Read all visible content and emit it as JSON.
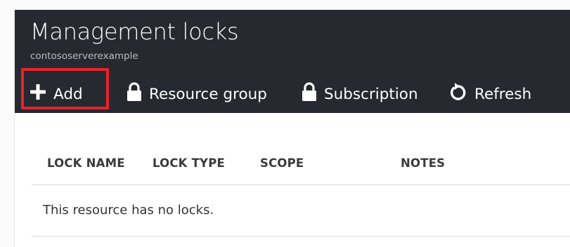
{
  "blade": {
    "title": "Management locks",
    "subtitle": "contososerverexample"
  },
  "toolbar": {
    "add_label": "Add",
    "resource_group_label": "Resource group",
    "subscription_label": "Subscription",
    "refresh_label": "Refresh"
  },
  "table": {
    "columns": [
      "LOCK NAME",
      "LOCK TYPE",
      "SCOPE",
      "NOTES"
    ],
    "empty_message": "This resource has no locks."
  },
  "colors": {
    "header_bg": "#262930",
    "highlight": "#e8222c"
  },
  "icons": {
    "add": "plus-icon",
    "resource_group": "lock-icon",
    "subscription": "lock-icon",
    "refresh": "refresh-icon"
  }
}
